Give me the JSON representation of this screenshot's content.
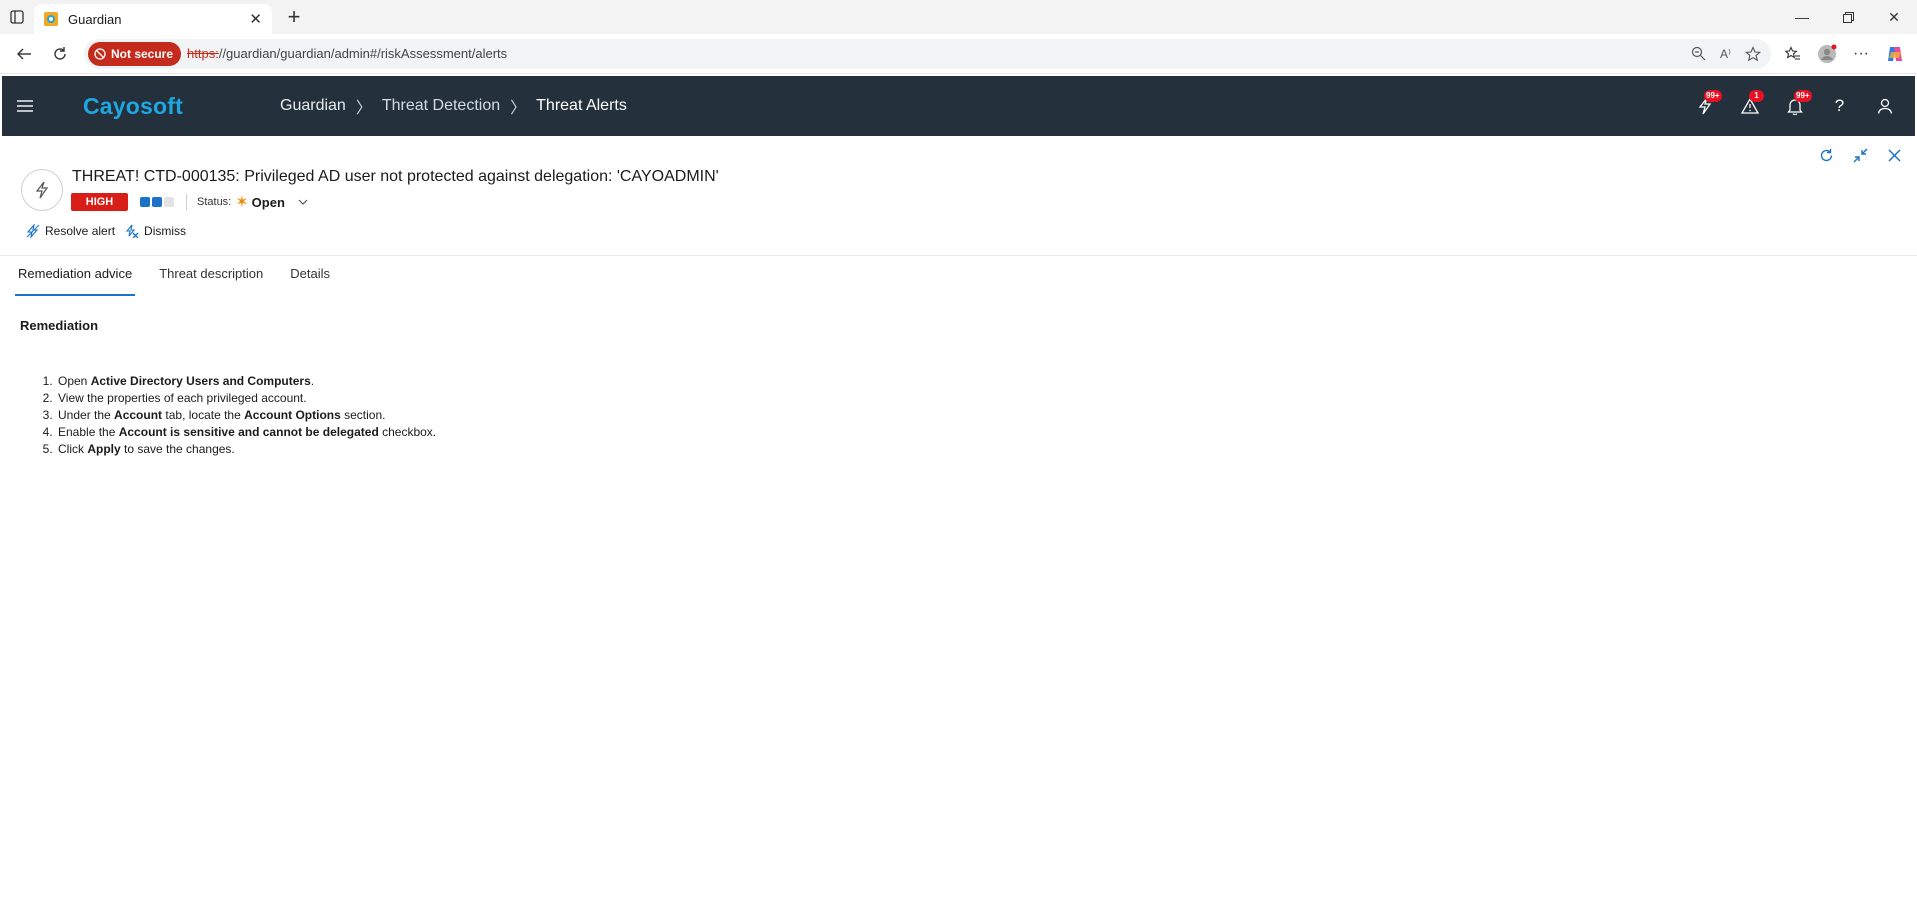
{
  "browser": {
    "tab_title": "Guardian",
    "url_scheme": "https:",
    "url_rest": "//guardian/guardian/admin#/riskAssessment/alerts",
    "security_label": "Not secure"
  },
  "app": {
    "logo": "Cayosoft",
    "breadcrumb": [
      "Guardian",
      "Threat Detection",
      "Threat Alerts"
    ],
    "badges": {
      "threats": "99+",
      "warnings": "1",
      "notifications": "99+"
    }
  },
  "alert": {
    "title": "THREAT! CTD-000135: Privileged AD user not protected against delegation: 'CAYOADMIN'",
    "severity": "HIGH",
    "severity_level": 2,
    "severity_max": 3,
    "status_label": "Status:",
    "status_value": "Open",
    "actions": {
      "resolve": "Resolve alert",
      "dismiss": "Dismiss"
    }
  },
  "tabs": [
    "Remediation advice",
    "Threat description",
    "Details"
  ],
  "remediation": {
    "title": "Remediation",
    "steps": [
      {
        "pre": "Open ",
        "b1": "Active Directory Users and Computers",
        "mid": ".",
        "b2": "",
        "post": ""
      },
      {
        "pre": "View the properties of each privileged account.",
        "b1": "",
        "mid": "",
        "b2": "",
        "post": ""
      },
      {
        "pre": "Under the ",
        "b1": "Account",
        "mid": " tab, locate the ",
        "b2": "Account Options",
        "post": " section."
      },
      {
        "pre": "Enable the ",
        "b1": "Account is sensitive and cannot be delegated",
        "mid": " checkbox.",
        "b2": "",
        "post": ""
      },
      {
        "pre": "Click ",
        "b1": "Apply",
        "mid": " to save the changes.",
        "b2": "",
        "post": ""
      }
    ]
  },
  "colors": {
    "brand": "#1ea7e1",
    "header_bg": "#25303d",
    "severity_high": "#d91e18",
    "accent": "#1a73c8",
    "status_open": "#f08c00"
  }
}
